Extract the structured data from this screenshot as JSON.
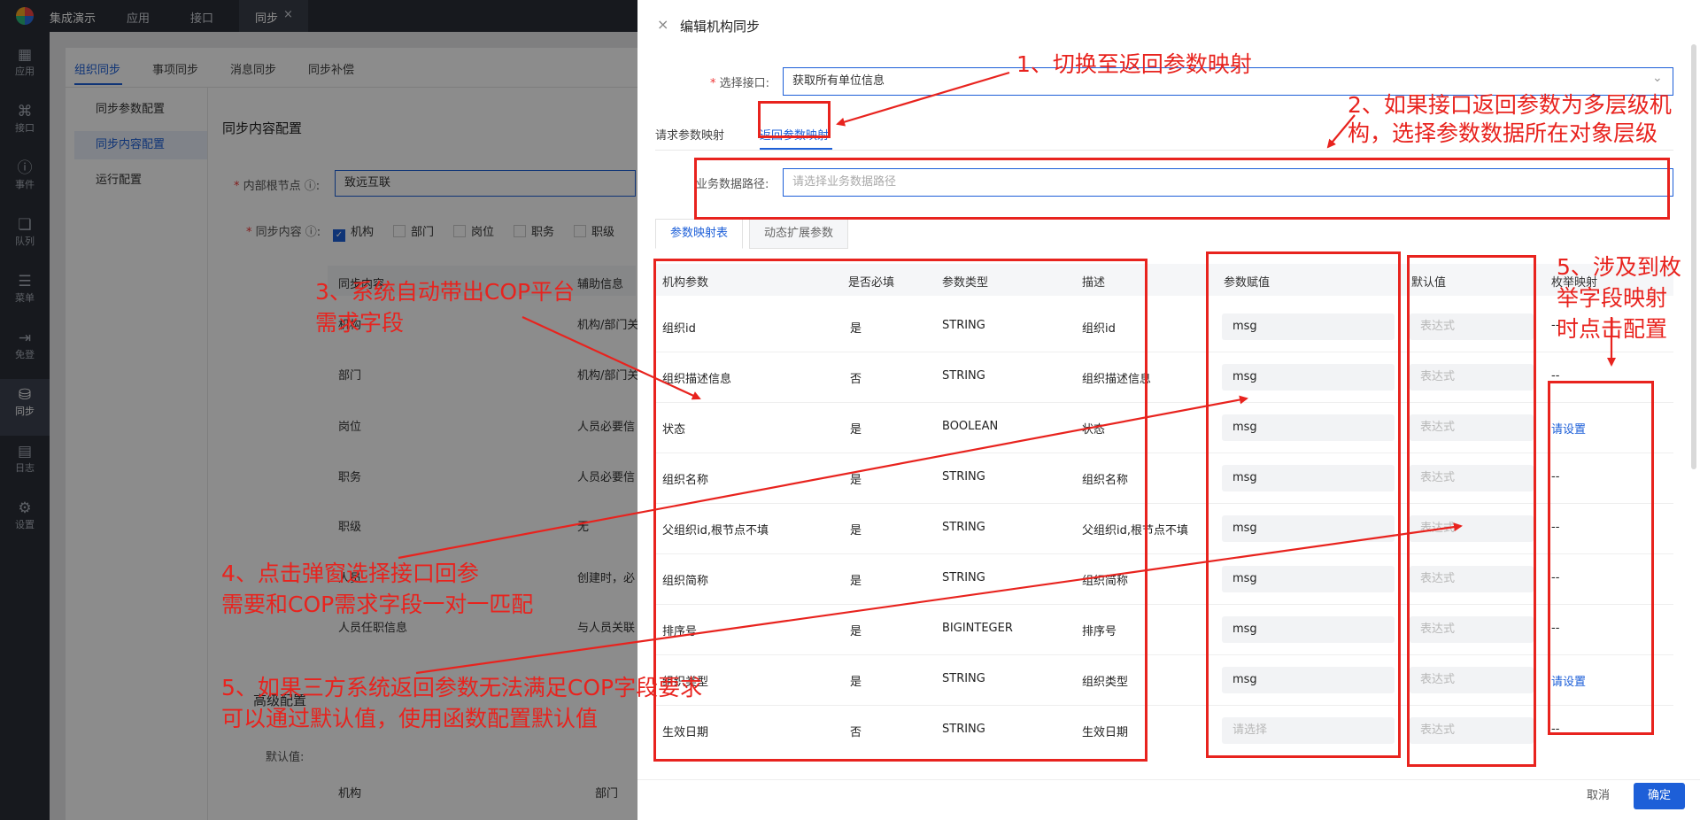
{
  "topbar": {
    "app_name": "集成演示",
    "tabs": [
      "应用",
      "接口",
      "同步"
    ],
    "close_glyph": "×"
  },
  "rail": [
    {
      "icon": "grid-icon",
      "label": "应用"
    },
    {
      "icon": "interface-icon",
      "label": "接口"
    },
    {
      "icon": "event-icon",
      "label": "事件"
    },
    {
      "icon": "queue-icon",
      "label": "队列"
    },
    {
      "icon": "menu-icon",
      "label": "菜单"
    },
    {
      "icon": "login-icon",
      "label": "免登"
    },
    {
      "icon": "database-icon",
      "label": "同步"
    },
    {
      "icon": "log-icon",
      "label": "日志"
    },
    {
      "icon": "gear-icon",
      "label": "设置"
    }
  ],
  "subtabs": [
    "组织同步",
    "事项同步",
    "消息同步",
    "同步补偿"
  ],
  "sidemenu": [
    "同步参数配置",
    "同步内容配置",
    "运行配置"
  ],
  "base": {
    "section_title": "同步内容配置",
    "root_label": "内部根节点",
    "root_value": "致远互联",
    "content_label": "同步内容",
    "checkbox_labels": [
      "机构",
      "部门",
      "岗位",
      "职务",
      "职级"
    ],
    "table_headers": [
      "同步内容",
      "辅助信息"
    ],
    "rows": [
      [
        "机构",
        "机构/部门关"
      ],
      [
        "部门",
        "机构/部门关"
      ],
      [
        "岗位",
        "人员必要信"
      ],
      [
        "职务",
        "人员必要信"
      ],
      [
        "职级",
        "无"
      ],
      [
        "人员",
        "创建时，必"
      ],
      [
        "人员任职信息",
        "与人员关联"
      ]
    ],
    "advanced_title": "高级配置",
    "default_label": "默认值",
    "bottom_headers": [
      "机构",
      "部门"
    ]
  },
  "drawer": {
    "title": "编辑机构同步",
    "close_glyph": "×",
    "select_label": "选择接口:",
    "select_value": "获取所有单位信息",
    "mapping_tabs": [
      "请求参数映射",
      "返回参数映射"
    ],
    "path_label": "业务数据路径:",
    "path_placeholder": "请选择业务数据路径",
    "inner_tabs": [
      "参数映射表",
      "动态扩展参数"
    ],
    "headers": [
      "机构参数",
      "是否必填",
      "参数类型",
      "描述",
      "参数赋值",
      "默认值",
      "枚举映射"
    ],
    "rows": [
      {
        "param": "组织id",
        "req": "是",
        "type": "STRING",
        "desc": "组织id",
        "value": "msg",
        "default": "表达式",
        "enum": "--"
      },
      {
        "param": "组织描述信息",
        "req": "否",
        "type": "STRING",
        "desc": "组织描述信息",
        "value": "msg",
        "default": "表达式",
        "enum": "--"
      },
      {
        "param": "状态",
        "req": "是",
        "type": "BOOLEAN",
        "desc": "状态",
        "value": "msg",
        "default": "表达式",
        "enum": "请设置"
      },
      {
        "param": "组织名称",
        "req": "是",
        "type": "STRING",
        "desc": "组织名称",
        "value": "msg",
        "default": "表达式",
        "enum": "--"
      },
      {
        "param": "父组织id,根节点不填",
        "req": "是",
        "type": "STRING",
        "desc": "父组织id,根节点不填",
        "value": "msg",
        "default": "表达式",
        "enum": "--"
      },
      {
        "param": "组织简称",
        "req": "是",
        "type": "STRING",
        "desc": "组织简称",
        "value": "msg",
        "default": "表达式",
        "enum": "--"
      },
      {
        "param": "排序号",
        "req": "是",
        "type": "BIGINTEGER",
        "desc": "排序号",
        "value": "msg",
        "default": "表达式",
        "enum": "--"
      },
      {
        "param": "组织类型",
        "req": "是",
        "type": "STRING",
        "desc": "组织类型",
        "value": "msg",
        "default": "表达式",
        "enum": "请设置"
      },
      {
        "param": "生效日期",
        "req": "否",
        "type": "STRING",
        "desc": "生效日期",
        "value": "请选择",
        "default": "表达式",
        "enum": "--"
      }
    ],
    "cancel": "取消",
    "ok": "确定"
  },
  "annotations": {
    "n1": "1、切换至返回参数映射",
    "n2a": "2、如果接口返回参数为多层级机",
    "n2b": "构，选择参数数据所在对象层级",
    "n3a": "3、系统自动带出COP平台",
    "n3b": "需求字段",
    "n4a": "4、点击弹窗选择接口回参",
    "n4b": "需要和COP需求字段一对一匹配",
    "n5a": "5、如果三方系统返回参数无法满足COP字段要求",
    "n5b": "可以通过默认值，使用函数配置默认值",
    "n6a": "5、涉及到枚",
    "n6b": "举字段映射",
    "n6c": "时点击配置",
    "color": "#e8231e"
  }
}
